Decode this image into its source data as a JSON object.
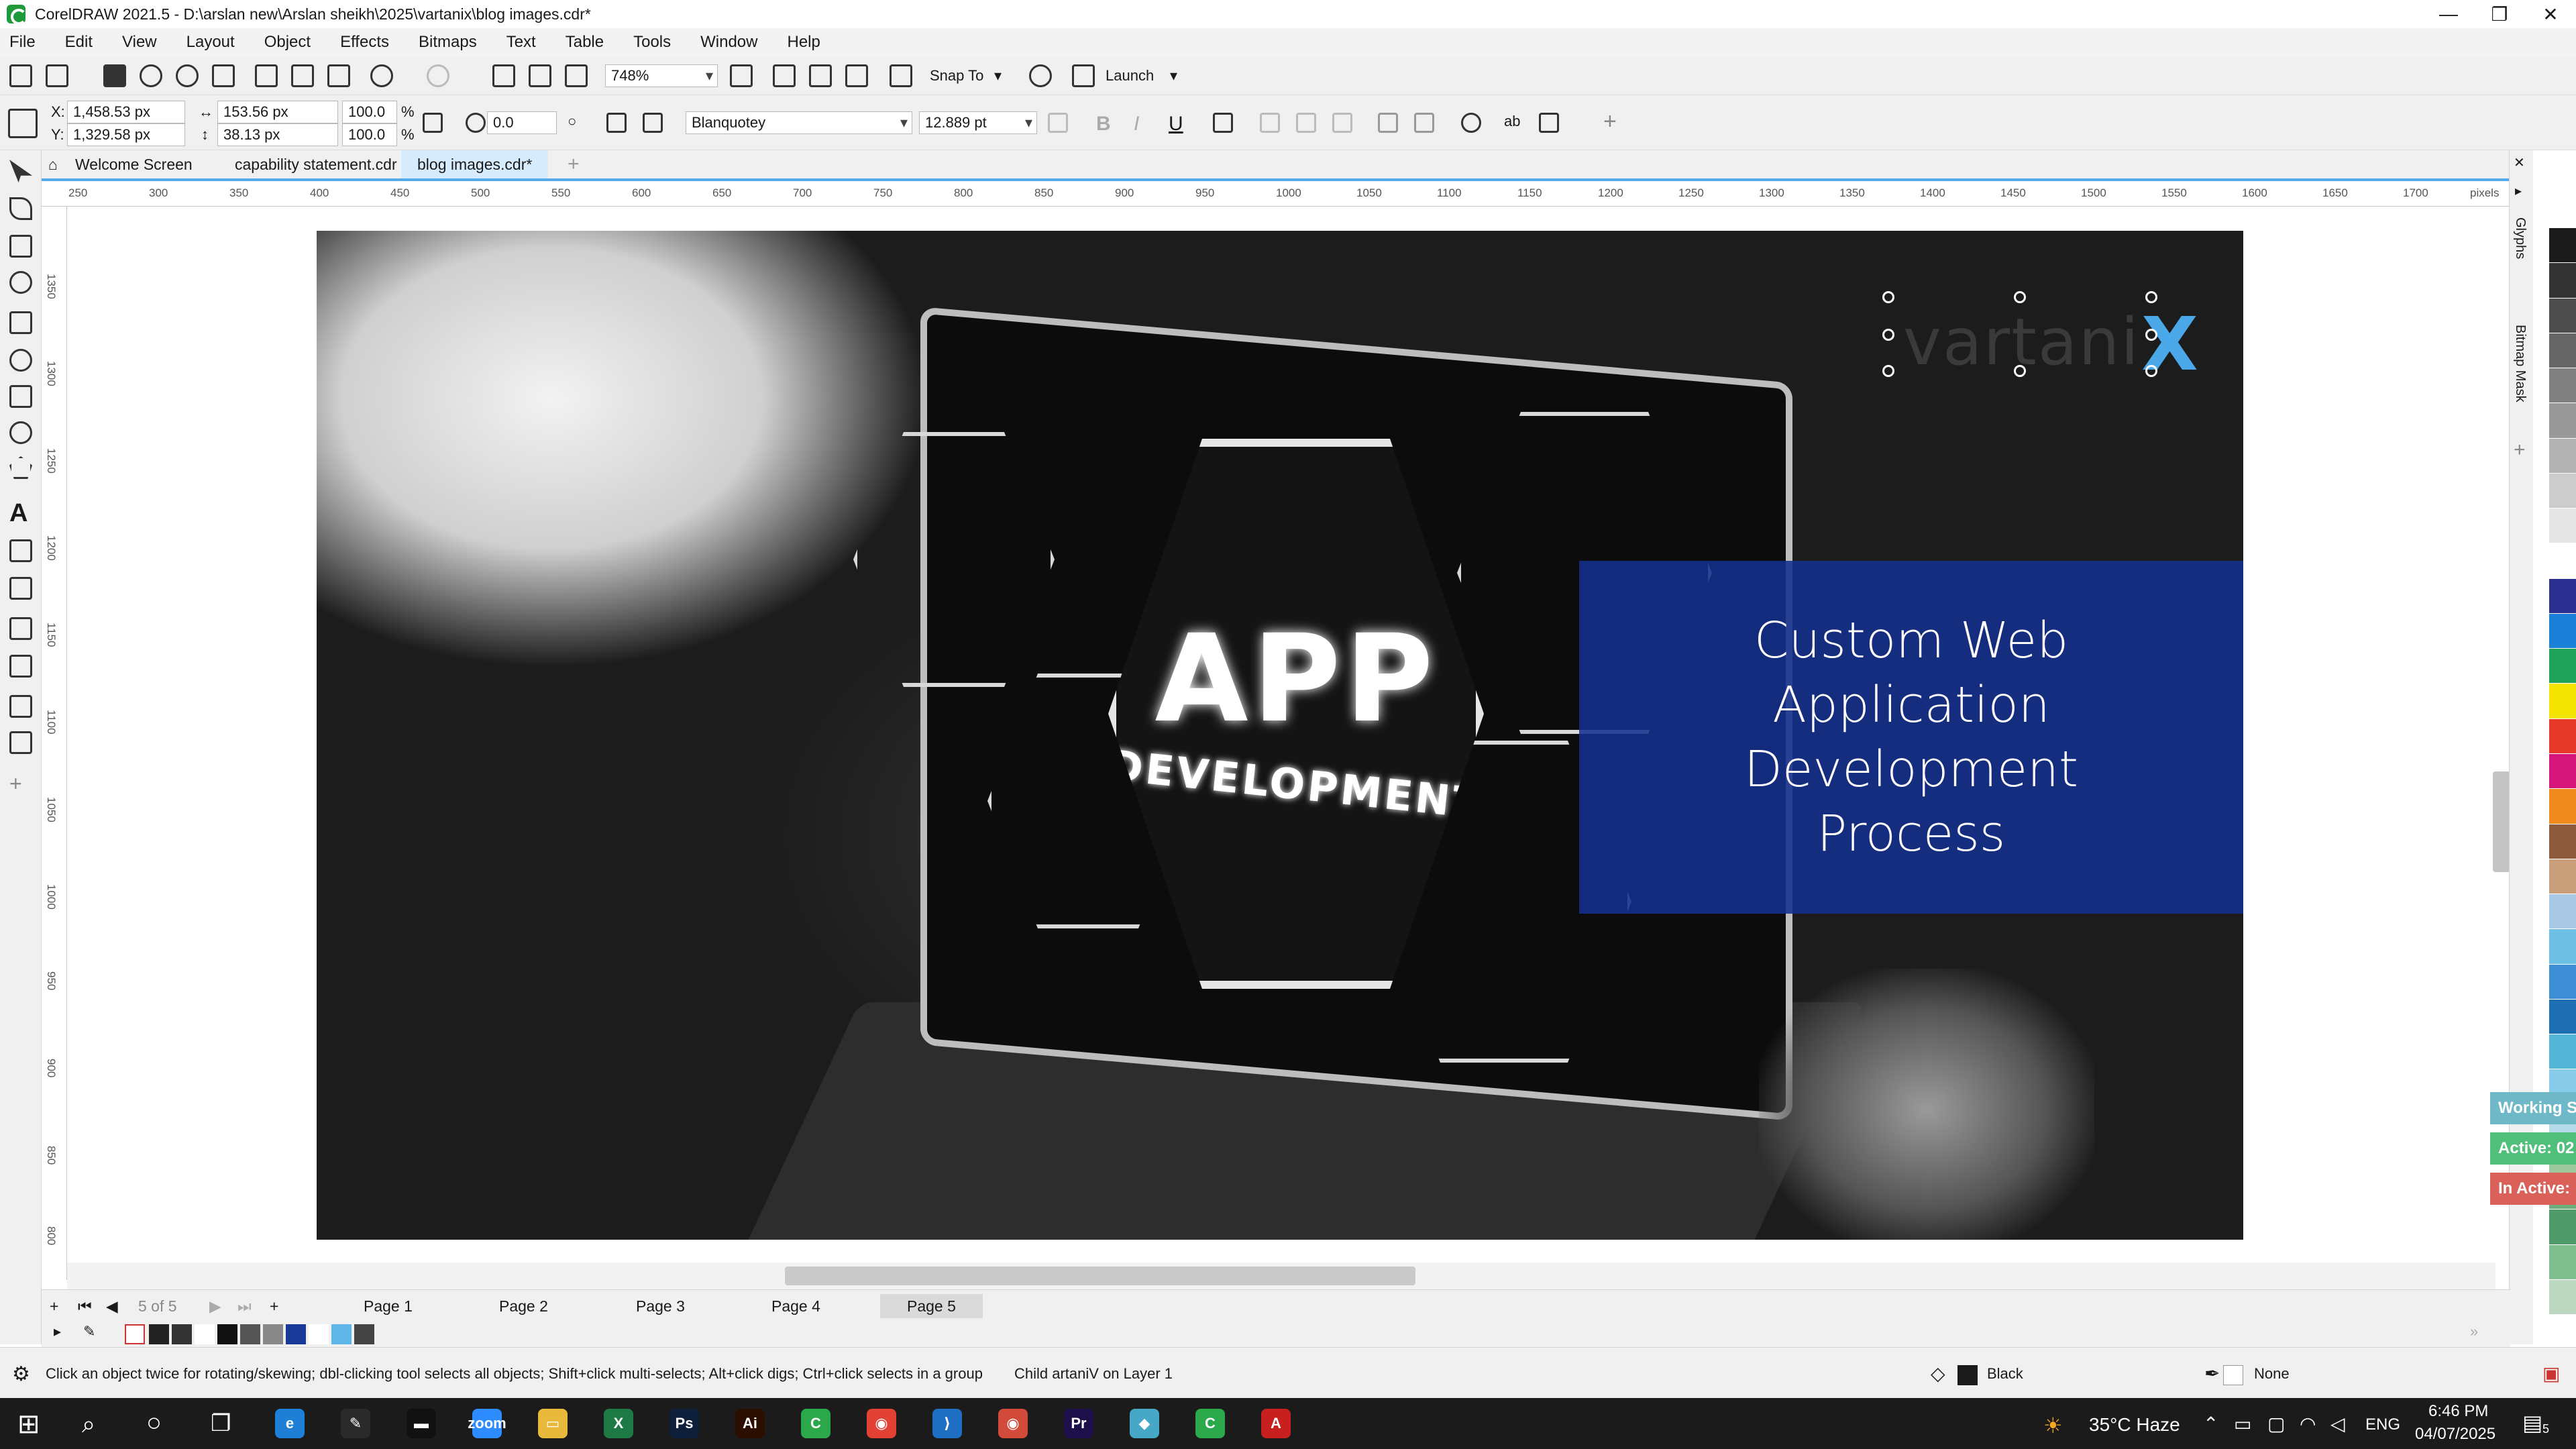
{
  "window": {
    "title": "CorelDRAW 2021.5 - D:\\arslan new\\Arslan sheikh\\2025\\vartanix\\blog images.cdr*",
    "minimize": "—",
    "maximize": "❐",
    "close": "✕"
  },
  "menu": [
    "File",
    "Edit",
    "View",
    "Layout",
    "Object",
    "Effects",
    "Bitmaps",
    "Text",
    "Table",
    "Tools",
    "Window",
    "Help"
  ],
  "toolbar": {
    "zoom": "748%",
    "snap_to": "Snap To",
    "launch": "Launch"
  },
  "property_bar": {
    "x_label": "X:",
    "x": "1,458.53 px",
    "y_label": "Y:",
    "y": "1,329.58 px",
    "width": "153.56 px",
    "height": "38.13 px",
    "scale_w": "100.0",
    "scale_h": "100.0",
    "percent": "%",
    "rotation": "0.0",
    "font": "Blanquotey",
    "font_size": "12.889 pt",
    "bold": "B",
    "italic": "I",
    "underline": "U",
    "ab": "ab",
    "plus": "+"
  },
  "doc_tabs": [
    "Welcome Screen",
    "capability statement.cdr",
    "blog images.cdr*"
  ],
  "ruler": {
    "top": [
      "250",
      "300",
      "350",
      "400",
      "450",
      "500",
      "550",
      "600",
      "650",
      "700",
      "750",
      "800",
      "850",
      "900",
      "950",
      "1000",
      "1050",
      "1100",
      "1150",
      "1200",
      "1250",
      "1300",
      "1350",
      "1400",
      "1450",
      "1500",
      "1550",
      "1600",
      "1650",
      "1700"
    ],
    "unit": "pixels",
    "left": [
      "1350",
      "1300",
      "1250",
      "1200",
      "1150",
      "1100",
      "1050",
      "1000",
      "950",
      "900",
      "850",
      "800"
    ]
  },
  "artwork": {
    "hex_main_big": "APP",
    "hex_main_small": "DEVELOPMENT",
    "logo_text": "vartani",
    "logo_x": "X",
    "headline": "Custom Web Application Development Process"
  },
  "docker_labels": [
    "Glyphs",
    "Bitmap Mask"
  ],
  "float_status": [
    "Working S",
    "Active: 02",
    "In Active:"
  ],
  "float_colors": [
    "#6fb8c7",
    "#4fbf7a",
    "#d9615a"
  ],
  "pages": {
    "counter": "5 of 5",
    "tabs": [
      "Page 1",
      "Page 2",
      "Page 3",
      "Page 4",
      "Page 5"
    ],
    "active": "Page 5"
  },
  "statusbar": {
    "hint": "Click an object twice for rotating/skewing; dbl-clicking tool selects all objects; Shift+click multi-selects; Alt+click digs; Ctrl+click selects in a group",
    "selection": "Child artaniV on Layer 1",
    "fill": "Black",
    "outline": "None"
  },
  "taskbar": {
    "weather": "35°C Haze",
    "lang": "ENG",
    "time": "6:46 PM",
    "date": "04/07/2025",
    "notification_count": "5",
    "apps": [
      {
        "label": "e",
        "color": "#1e7fd6"
      },
      {
        "label": "✎",
        "color": "#2a2a2a"
      },
      {
        "label": "▬",
        "color": "#111111"
      },
      {
        "label": "zoom",
        "color": "#2d8cff"
      },
      {
        "label": "▭",
        "color": "#e8b93a"
      },
      {
        "label": "X",
        "color": "#1d7a45"
      },
      {
        "label": "Ps",
        "color": "#0d1f3a"
      },
      {
        "label": "Ai",
        "color": "#2b0e00"
      },
      {
        "label": "C",
        "color": "#2aa84a"
      },
      {
        "label": "◉",
        "color": "#e34133"
      },
      {
        "label": "⟩",
        "color": "#1f6fc4"
      },
      {
        "label": "◉",
        "color": "#d24a3a"
      },
      {
        "label": "Pr",
        "color": "#1c0f4a"
      },
      {
        "label": "◆",
        "color": "#46a7c7"
      },
      {
        "label": "C",
        "color": "#2aa84a"
      },
      {
        "label": "A",
        "color": "#c8201f"
      }
    ]
  },
  "palette_colors": [
    "#1a1a1a",
    "#333333",
    "#4d4d4d",
    "#666666",
    "#808080",
    "#999999",
    "#b3b3b3",
    "#cccccc",
    "#e6e6e6",
    "#ffffff",
    "#2b2f8f",
    "#1b80d8",
    "#1fa35a",
    "#f2e400",
    "#e83a2a",
    "#d6157a",
    "#f08a1c",
    "#8b5a3c",
    "#c89f7a",
    "#a9c8e6",
    "#6ec1e4",
    "#3f8fd6",
    "#1f6fb3",
    "#56b6d8",
    "#88cbe9",
    "#b5dbe9",
    "#9ec89e",
    "#6fae7d",
    "#4f9c6a",
    "#7fbf8f",
    "#bdd8c1"
  ],
  "doc_swatches": [
    "#222222",
    "#333333",
    "#ffffff",
    "#111111",
    "#555555",
    "#888888",
    "#1a3a9a",
    "#ffffff",
    "#5fb6e8",
    "#444444"
  ]
}
